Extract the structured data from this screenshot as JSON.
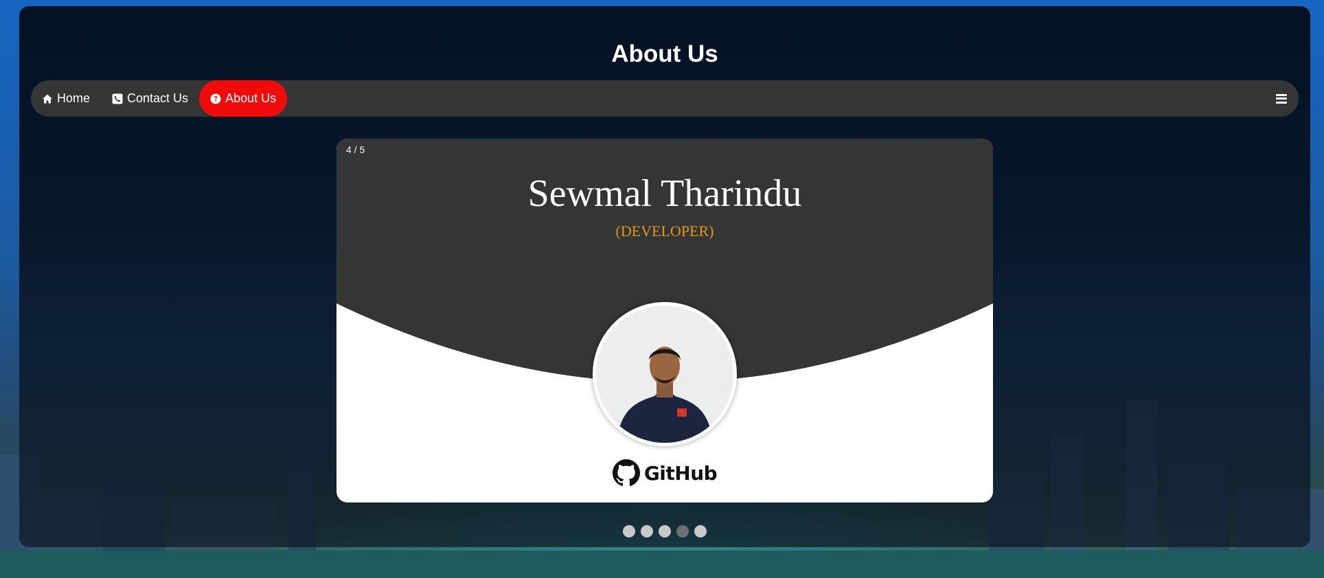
{
  "header": {
    "title": "About Us"
  },
  "nav": {
    "items": [
      {
        "label": "Home",
        "icon": "home-icon"
      },
      {
        "label": "Contact Us",
        "icon": "phone-icon"
      },
      {
        "label": "About Us",
        "icon": "question-circle-icon",
        "active": true
      }
    ],
    "menu_icon": "hamburger-menu-icon"
  },
  "slider": {
    "counter": "4 / 5",
    "current": 4,
    "total": 5,
    "member": {
      "name": "Sewmal Tharindu",
      "role": "(DEVELOPER)"
    },
    "github_label": "GitHub"
  },
  "colors": {
    "accent": "#f00a0a",
    "nav_bg": "#353535",
    "role_color": "#e39a1c",
    "card_dark": "#353535"
  }
}
